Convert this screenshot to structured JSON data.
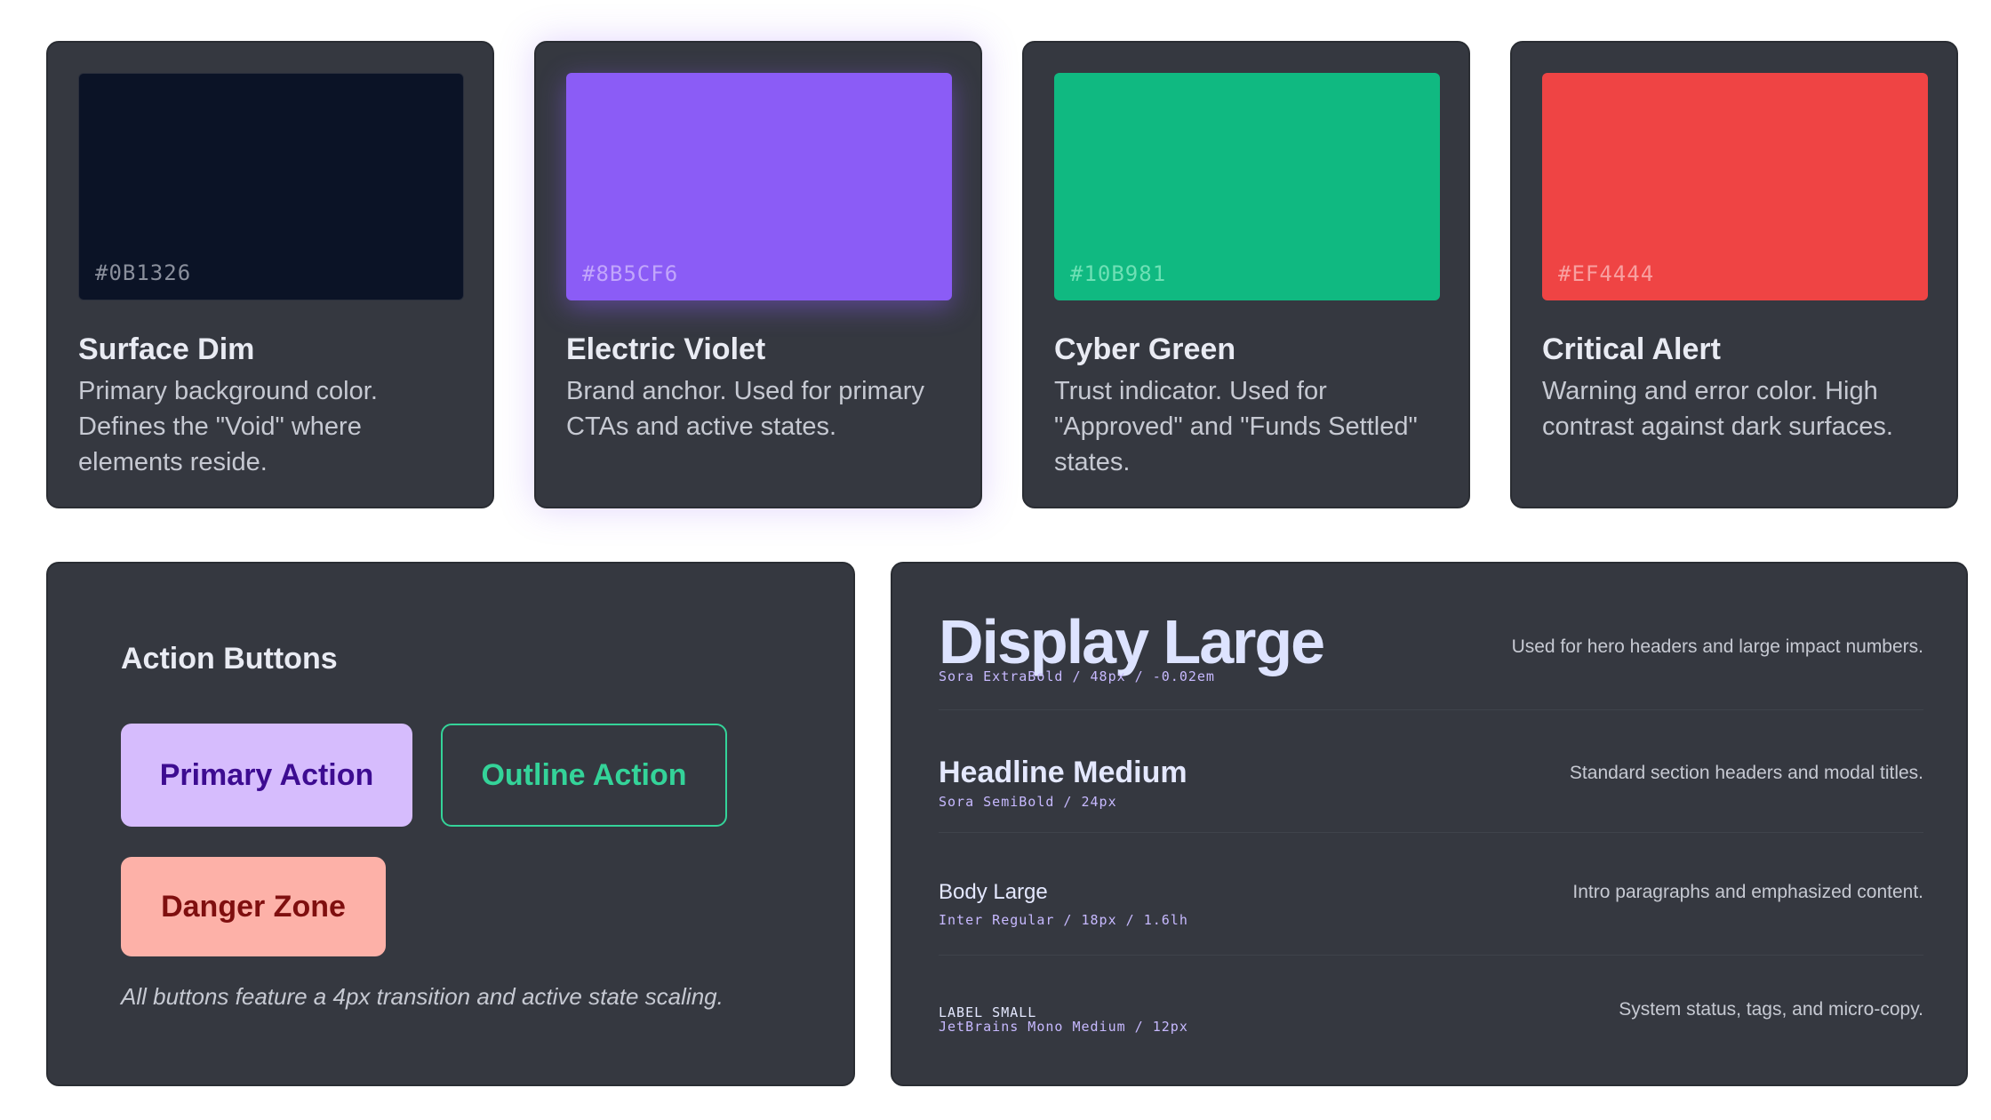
{
  "colors": [
    {
      "hex": "#0B1326",
      "name": "Surface Dim",
      "description": "Primary background color. Defines the \"Void\" where elements reside."
    },
    {
      "hex": "#8B5CF6",
      "name": "Electric Violet",
      "description": "Brand anchor. Used for primary CTAs and active states."
    },
    {
      "hex": "#10B981",
      "name": "Cyber Green",
      "description": "Trust indicator. Used for \"Approved\" and \"Funds Settled\" states."
    },
    {
      "hex": "#EF4444",
      "name": "Critical Alert",
      "description": "Warning and error color. High contrast against dark surfaces."
    }
  ],
  "buttons_panel": {
    "title": "Action Buttons",
    "primary_label": "Primary Action",
    "outline_label": "Outline Action",
    "danger_label": "Danger Zone",
    "note": "All buttons feature a 4px transition and active state scaling."
  },
  "typography": [
    {
      "name": "Display Large",
      "spec": "Sora ExtraBold / 48px / -0.02em",
      "description": "Used for hero headers and large impact numbers."
    },
    {
      "name": "Headline Medium",
      "spec": "Sora SemiBold / 24px",
      "description": "Standard section headers and modal titles."
    },
    {
      "name": "Body Large",
      "spec": "Inter Regular / 18px / 1.6lh",
      "description": "Intro paragraphs and emphasized content."
    },
    {
      "name": "LABEL SMALL",
      "spec": "JetBrains Mono Medium / 12px",
      "description": "System status, tags, and micro-copy."
    }
  ]
}
